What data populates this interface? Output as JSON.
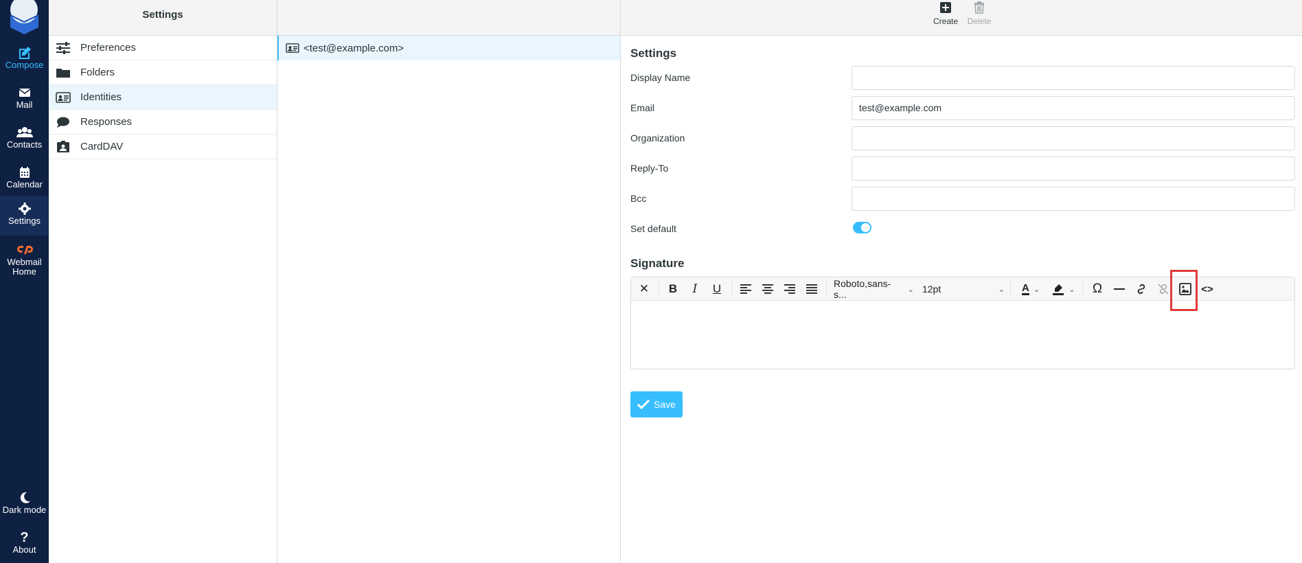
{
  "nav": {
    "items": [
      {
        "label": "Compose",
        "icon": "compose-icon"
      },
      {
        "label": "Mail",
        "icon": "mail-icon"
      },
      {
        "label": "Contacts",
        "icon": "contacts-icon"
      },
      {
        "label": "Calendar",
        "icon": "calendar-icon"
      },
      {
        "label": "Settings",
        "icon": "gear-icon"
      },
      {
        "label": "Webmail Home",
        "icon": "cpanel-icon"
      }
    ],
    "bottom": [
      {
        "label": "Dark mode",
        "icon": "moon-icon"
      },
      {
        "label": "About",
        "icon": "question-icon"
      }
    ]
  },
  "settings_menu": {
    "title": "Settings",
    "items": [
      {
        "label": "Preferences",
        "icon": "sliders-icon"
      },
      {
        "label": "Folders",
        "icon": "folder-icon"
      },
      {
        "label": "Identities",
        "icon": "id-card-icon"
      },
      {
        "label": "Responses",
        "icon": "comment-icon"
      },
      {
        "label": "CardDAV",
        "icon": "address-book-icon"
      }
    ],
    "selected": "Identities"
  },
  "identities": {
    "items": [
      {
        "label": "<test@example.com>"
      }
    ]
  },
  "toolbar": {
    "create_label": "Create",
    "delete_label": "Delete"
  },
  "form": {
    "section_title": "Settings",
    "display_name_label": "Display Name",
    "display_name_value": "",
    "email_label": "Email",
    "email_value": "test@example.com",
    "organization_label": "Organization",
    "organization_value": "",
    "reply_to_label": "Reply-To",
    "reply_to_value": "",
    "bcc_label": "Bcc",
    "bcc_value": "",
    "set_default_label": "Set default",
    "set_default_on": true
  },
  "signature": {
    "title": "Signature",
    "font_family": "Roboto,sans-s...",
    "font_size": "12pt"
  },
  "save_label": "Save",
  "colors": {
    "nav_bg": "#0f2143",
    "accent": "#37beff",
    "highlight": "#e33a3a"
  }
}
